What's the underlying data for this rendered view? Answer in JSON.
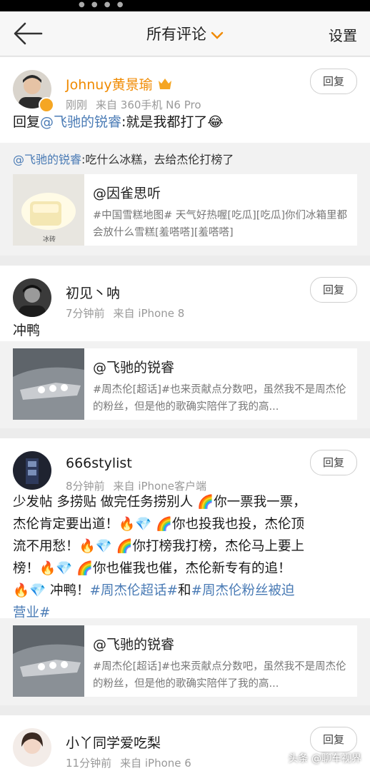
{
  "header": {
    "title": "所有评论",
    "settings_label": "设置"
  },
  "comments": [
    {
      "name": "Johnuy黄景瑜",
      "time": "刚刚",
      "source": "来自 360手机 N6 Pro",
      "reply_label": "回复",
      "reply_prefix": "回复",
      "mention": "@飞驰的锐睿",
      "text": ":就是我都打了😂",
      "quote_mention": "@飞驰的锐睿",
      "quote_text": ":吃什么冰糕，去给杰伦打榜了",
      "embed": {
        "title": "@因雀思听",
        "desc": "#中国雪糕地图# 天气好热喔[吃瓜][吃瓜]你们冰箱里都会放什么雪糕[羞嗒嗒][羞嗒嗒]",
        "thumb_caption": "冰砖"
      }
    },
    {
      "name": "初见丶呐",
      "time": "7分钟前",
      "source": "来自 iPhone 8",
      "reply_label": "回复",
      "text": "冲鸭",
      "embed": {
        "title": "@飞驰的锐睿",
        "desc": "#周杰伦[超话]#也来贡献点分数吧，虽然我不是周杰伦的粉丝，但是他的歌确实陪伴了我的高..."
      }
    },
    {
      "name": "666stylist",
      "time": "8分钟前",
      "source": "来自 iPhone客户端",
      "reply_label": "回复",
      "line1": "少发帖 多捞贴 做完任务捞别人 🌈你一票我一票，",
      "line2": "杰伦肯定要出道！🔥💎 🌈你也投我也投，杰伦顶",
      "line3": "流不用愁！🔥💎 🌈你打榜我打榜，杰伦马上要上",
      "line4": "榜！🔥💎 🌈你也催我也催，杰伦新专有的追！",
      "line5_prefix": "🔥💎 冲鸭！",
      "topic1": "#周杰伦超话#",
      "and": "和",
      "topic2a": "#周杰伦粉丝被迫",
      "topic2b": "营业#",
      "embed": {
        "title": "@飞驰的锐睿",
        "desc": "#周杰伦[超话]#也来贡献点分数吧，虽然我不是周杰伦的粉丝，但是他的歌确实陪伴了我的高..."
      }
    },
    {
      "name": "小丫同学爱吃梨",
      "time": "11分钟前",
      "source": "来自 iPhone 6",
      "reply_label": "回复"
    }
  ],
  "watermark": "头条 @聊车视界",
  "colors": {
    "link": "#4a7bb5",
    "vip_name": "#f08a00",
    "badge": "#f5a623"
  }
}
